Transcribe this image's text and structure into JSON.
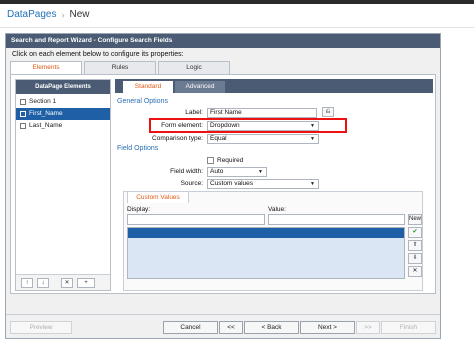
{
  "breadcrumb": {
    "root": "DataPages",
    "current": "New",
    "separator": "›"
  },
  "dialog": {
    "title": "Search and Report Wizard - Configure Search Fields",
    "instruction": "Click on each element below to configure its properties:"
  },
  "main_tabs": [
    "Elements",
    "Rules",
    "Logic"
  ],
  "elements_panel": {
    "header": "DataPage Elements",
    "items": [
      "Section 1",
      "First_Name",
      "Last_Name"
    ],
    "toolbar": {
      "up": "↑",
      "down": "↓",
      "delete": "✕",
      "add": "+"
    }
  },
  "sub_tabs": [
    "Standard",
    "Advanced"
  ],
  "general_options": {
    "heading": "General Options",
    "label_caption": "Label:",
    "label_value": "First Name",
    "form_element_caption": "Form element:",
    "form_element_value": "Dropdown",
    "comparison_caption": "Comparison type:",
    "comparison_value": "Equal"
  },
  "field_options": {
    "heading": "Field Options",
    "required_label": "Required",
    "field_width_caption": "Field width:",
    "field_width_value": "Auto",
    "source_caption": "Source:",
    "source_value": "Custom values"
  },
  "custom_values": {
    "tab": "Custom Values",
    "display_label": "Display:",
    "value_label": "Value:",
    "new_button": "New",
    "accept_icon": "✔",
    "up_icon": "⬆",
    "down_icon": "⬇",
    "delete_icon": "✕"
  },
  "footer": {
    "preview": "Preview",
    "cancel": "Cancel",
    "first": "<<",
    "back": "< Back",
    "next": "Next >",
    "last": ">>",
    "finish": "Finish"
  },
  "colors": {
    "header_bar": "#4a5b73",
    "accent_orange": "#e05a14",
    "link_blue": "#1f72b8",
    "selection_blue": "#1f5fa6",
    "highlight_red": "#ee1111"
  }
}
